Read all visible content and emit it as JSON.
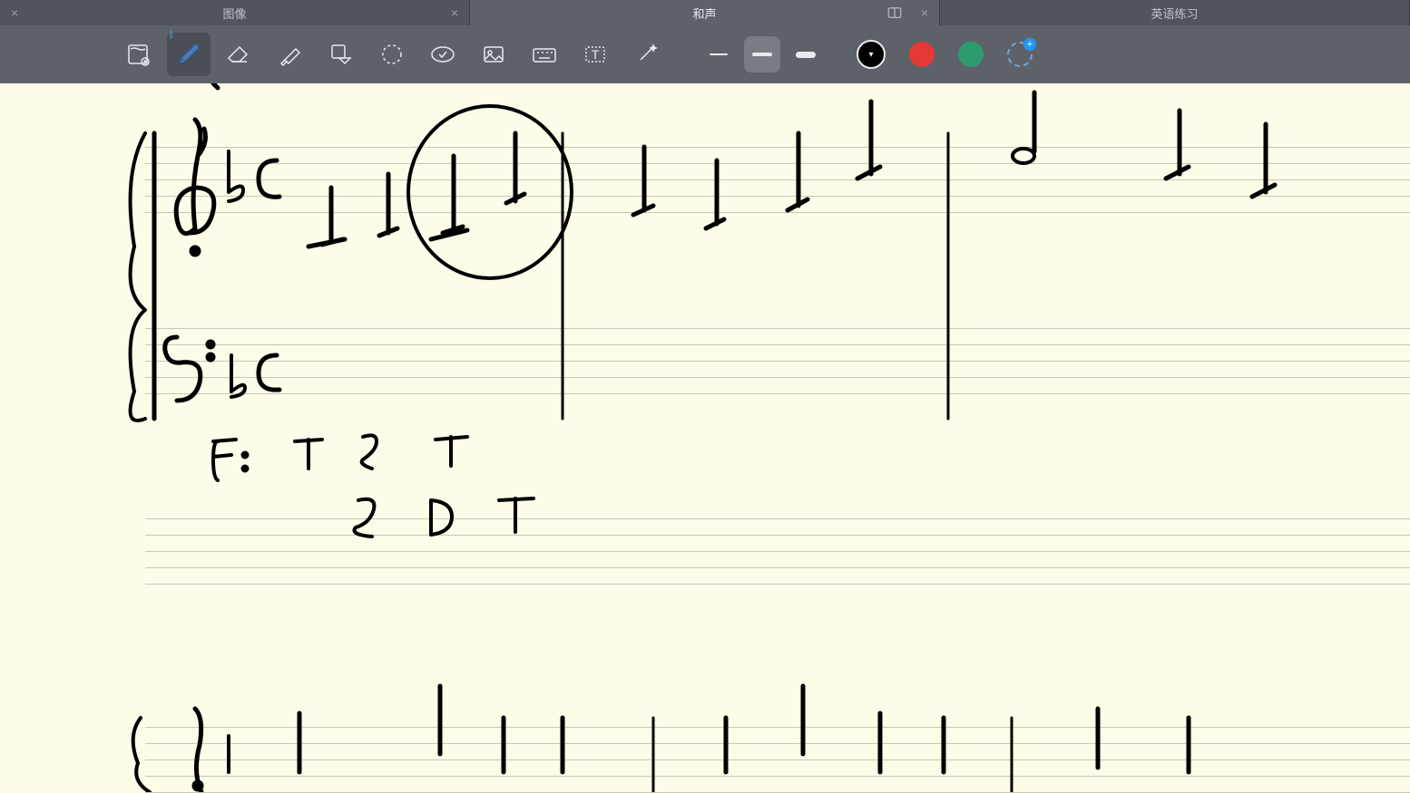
{
  "tabs": [
    {
      "label": "图像",
      "active": false
    },
    {
      "label": "和声",
      "active": true
    },
    {
      "label": "英语练习",
      "active": false
    }
  ],
  "tools": {
    "add_page": "add-page",
    "pen": "pen",
    "eraser": "eraser",
    "highlighter": "highlighter",
    "shape": "shape",
    "lasso": "lasso",
    "stamp": "stamp",
    "image": "image",
    "keyboard": "keyboard",
    "text": "text",
    "magic": "magic"
  },
  "strokes": [
    "thin",
    "medium",
    "thick"
  ],
  "selected_stroke": "medium",
  "colors": {
    "black": "#000000",
    "red": "#e53935",
    "green": "#2e9b6f"
  },
  "selected_color": "black",
  "annotations": {
    "key": "F:",
    "row1": [
      "T",
      "S",
      "T"
    ],
    "row2": [
      "S",
      "D",
      "T"
    ]
  }
}
